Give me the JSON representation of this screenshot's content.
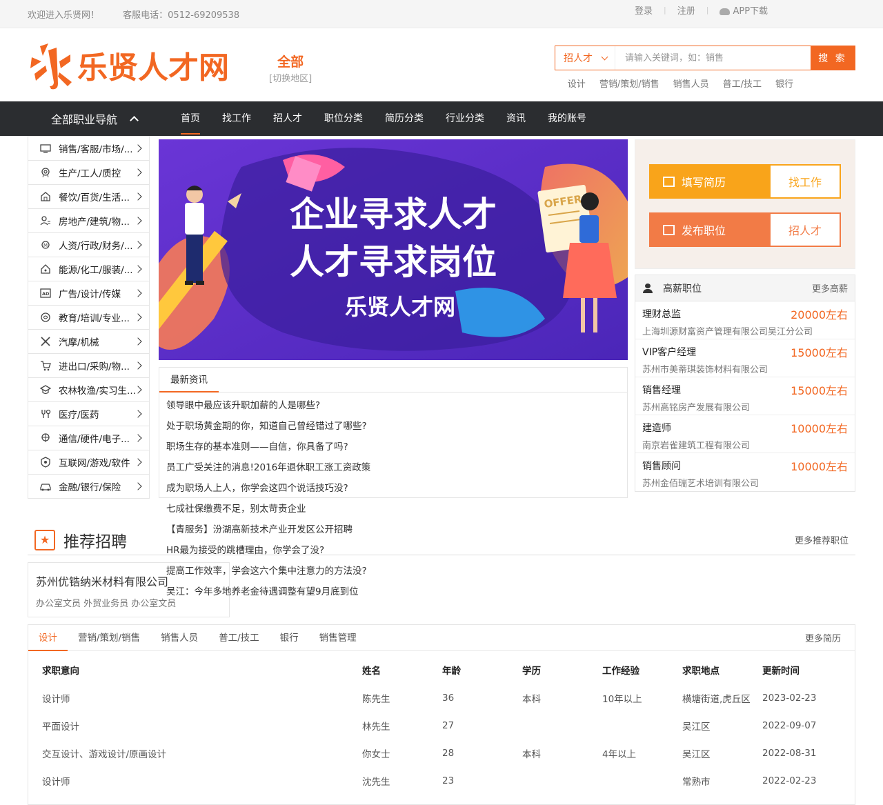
{
  "topbar": {
    "welcome": "欢迎进入乐贤网！",
    "phone": "客服电话：0512-69209538",
    "login": "登录",
    "register": "注册",
    "app": "APP下载"
  },
  "header": {
    "logo_mark": "乐",
    "logo_text": "乐贤人才网",
    "city": "全部",
    "city_switch": "[切换地区]",
    "search_type": "招人才",
    "search_placeholder": "请输入关键词，如：销售",
    "search_button": "搜 索",
    "hotwords": [
      "设计",
      "营销/策划/销售",
      "销售人员",
      "普工/技工",
      "银行"
    ]
  },
  "nav": {
    "all_categories": "全部职业导航",
    "items": [
      "首页",
      "找工作",
      "招人才",
      "职位分类",
      "简历分类",
      "行业分类",
      "资讯",
      "我的账号"
    ],
    "active_index": 0
  },
  "sidebar": {
    "items": [
      {
        "label": "销售/客服/市场/...",
        "icon": "monitor-icon"
      },
      {
        "label": "生产/工人/质控",
        "icon": "factory-icon"
      },
      {
        "label": "餐饮/百货/生活...",
        "icon": "store-icon"
      },
      {
        "label": "房地产/建筑/物...",
        "icon": "building-icon"
      },
      {
        "label": "人资/行政/财务/...",
        "icon": "people-icon"
      },
      {
        "label": "能源/化工/服装/...",
        "icon": "home-icon"
      },
      {
        "label": "广告/设计/传媒",
        "icon": "ad-icon"
      },
      {
        "label": "教育/培训/专业...",
        "icon": "education-icon"
      },
      {
        "label": "汽摩/机械",
        "icon": "tools-icon"
      },
      {
        "label": "进出口/采购/物...",
        "icon": "cart-icon"
      },
      {
        "label": "农林牧渔/实习生...",
        "icon": "graduation-icon"
      },
      {
        "label": "医疗/医药",
        "icon": "medical-icon"
      },
      {
        "label": "通信/硬件/电子...",
        "icon": "network-icon"
      },
      {
        "label": "互联网/游戏/软件",
        "icon": "game-icon"
      },
      {
        "label": "金融/银行/保险",
        "icon": "car-icon"
      }
    ]
  },
  "banner": {
    "line1": "企业寻求人才",
    "line2": "人才寻求岗位",
    "line3": "乐贤人才网",
    "offer": "OFFER"
  },
  "news": {
    "tab": "最新资讯",
    "items": [
      "领导眼中最应该升职加薪的人是哪些?",
      "处于职场黄金期的你，知道自己曾经错过了哪些?",
      "职场生存的基本准则——自信，你具备了吗?",
      "员工广受关注的消息!2016年退休职工涨工资政策",
      "成为职场人上人，你学会这四个说话技巧没?",
      "七成社保缴费不足，别太苛责企业",
      "【青服务】汾湖高新技术产业开发区公开招聘",
      "HR最为接受的跳槽理由，你学会了没?",
      "提高工作效率，学会这六个集中注意力的方法没?",
      "吴江：今年多地养老金待遇调整有望9月底到位"
    ]
  },
  "promo": {
    "resume_label": "填写简历",
    "find_job": "找工作",
    "post_label": "发布职位",
    "find_talent": "招人才"
  },
  "high_salary": {
    "title": "高薪职位",
    "more": "更多高薪",
    "jobs": [
      {
        "title": "理财总监",
        "salary": "20000左右",
        "company": "上海圳源财富资产管理有限公司吴江分公司"
      },
      {
        "title": "VIP客户经理",
        "salary": "15000左右",
        "company": "苏州市美蒂琪装饰材料有限公司"
      },
      {
        "title": "销售经理",
        "salary": "15000左右",
        "company": "苏州高铭房产发展有限公司"
      },
      {
        "title": "建造师",
        "salary": "10000左右",
        "company": "南京岩雀建筑工程有限公司"
      },
      {
        "title": "销售顾问",
        "salary": "10000左右",
        "company": "苏州金佰瑞艺术培训有限公司"
      }
    ]
  },
  "recommend": {
    "title": "推荐招聘",
    "more": "更多推荐职位",
    "company": "苏州优锆纳米材料有限公司",
    "jobs": "办公室文员 外贸业务员 办公室文员"
  },
  "resumes": {
    "tabs": [
      "设计",
      "营销/策划/销售",
      "销售人员",
      "普工/技工",
      "银行",
      "销售管理"
    ],
    "active_tab": 0,
    "more": "更多简历",
    "headers": [
      "求职意向",
      "姓名",
      "年龄",
      "学历",
      "工作经验",
      "求职地点",
      "更新时间"
    ],
    "rows": [
      [
        "设计师",
        "陈先生",
        "36",
        "本科",
        "10年以上",
        "横塘街道,虎丘区",
        "2023-02-23"
      ],
      [
        "平面设计",
        "林先生",
        "27",
        "",
        "",
        "吴江区",
        "2022-09-07"
      ],
      [
        "交互设计、游戏设计/原画设计",
        "你女士",
        "28",
        "本科",
        "4年以上",
        "吴江区",
        "2022-08-31"
      ],
      [
        "设计师",
        "沈先生",
        "23",
        "",
        "",
        "常熟市",
        "2022-02-23"
      ]
    ]
  },
  "colors": {
    "accent": "#f26722",
    "nav_bg": "#2b2d30",
    "promo_yellow": "#f9a41a",
    "promo_orange": "#f27b46"
  }
}
